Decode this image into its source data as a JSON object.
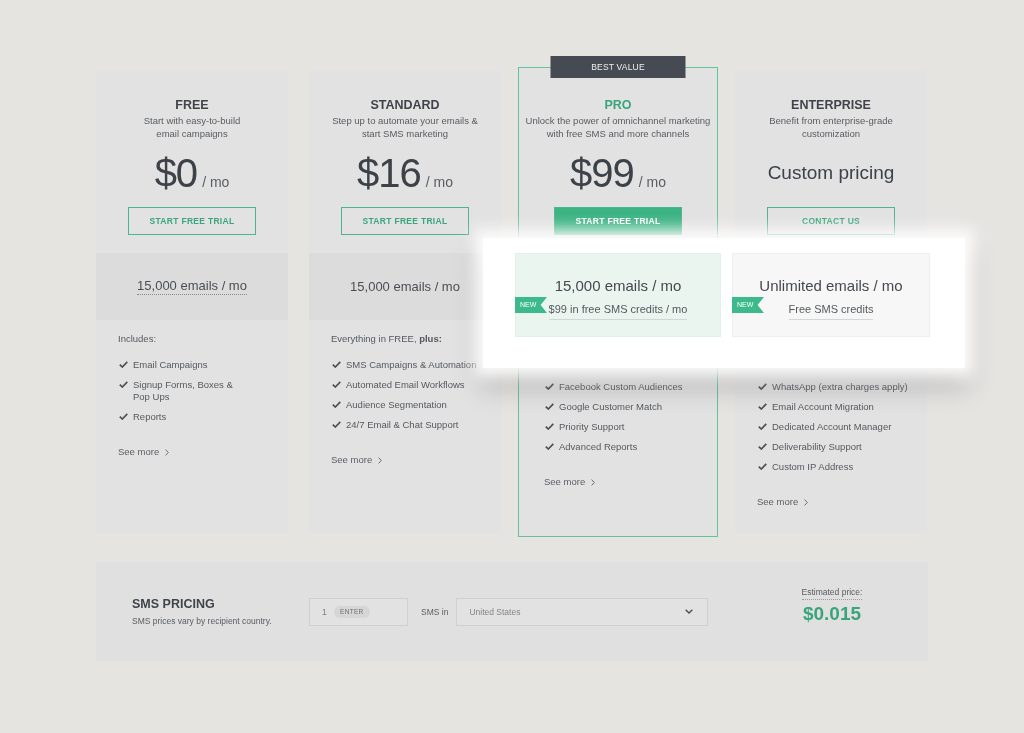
{
  "plans": [
    {
      "name": "FREE",
      "description": "Start with easy-to-build\nemail campaigns",
      "price": {
        "kind": "amount",
        "amount": "$0",
        "period": "/ mo"
      },
      "button": {
        "label": "START FREE TRIAL",
        "kind": "outline"
      },
      "highlighted": false,
      "emails": {
        "text": "15,000 emails / mo",
        "tooltip": true
      },
      "features_intro": "Includes:",
      "features": [
        "Email Campaigns",
        "Signup Forms, Boxes &\nPop Ups",
        "Reports"
      ],
      "see_more": "See more"
    },
    {
      "name": "STANDARD",
      "description": "Step up to automate your emails &\nstart SMS marketing",
      "price": {
        "kind": "amount",
        "amount": "$16",
        "period": "/ mo"
      },
      "button": {
        "label": "START FREE TRIAL",
        "kind": "outline"
      },
      "highlighted": false,
      "emails": {
        "text": "15,000 emails / mo",
        "tooltip": false
      },
      "features_intro": "Everything in FREE, **plus:**",
      "features": [
        "SMS Campaigns & Automation",
        "Automated Email Workflows",
        "Audience Segmentation",
        "24/7 Email & Chat Support"
      ],
      "see_more": "See more"
    },
    {
      "name": "PRO",
      "badge": "BEST VALUE",
      "description": "Unlock the power of omnichannel marketing\nwith free SMS and more channels",
      "price": {
        "kind": "amount",
        "amount": "$99",
        "period": "/ mo"
      },
      "button": {
        "label": "START FREE TRIAL",
        "kind": "filled"
      },
      "highlighted": true,
      "spotlight": {
        "emails": "15,000 emails / mo",
        "badge": "NEW",
        "note": "$99 in free SMS credits / mo"
      },
      "features": [
        "Facebook Custom Audiences",
        "Google Customer Match",
        "Priority Support",
        "Advanced Reports"
      ],
      "see_more": "See more"
    },
    {
      "name": "ENTERPRISE",
      "description": "Benefit from enterprise-grade\ncustomization",
      "price": {
        "kind": "custom",
        "label": "Custom pricing"
      },
      "button": {
        "label": "CONTACT US",
        "kind": "outline"
      },
      "highlighted": false,
      "spotlight": {
        "emails": "Unlimited emails / mo",
        "badge": "NEW",
        "note": "Free SMS credits"
      },
      "features": [
        "WhatsApp (extra charges apply)",
        "Email Account Migration",
        "Dedicated Account Manager",
        "Deliverability Support",
        "Custom IP Address"
      ],
      "see_more": "See more"
    }
  ],
  "sms_pricing": {
    "title": "SMS PRICING",
    "subtitle": "SMS prices vary by recipient country.",
    "quantity": {
      "placeholder": "1",
      "hint": "ENTER"
    },
    "country_label": "SMS in",
    "country": {
      "placeholder": "United States"
    },
    "estimate_label": "Estimated price:",
    "estimate": "$0.015"
  }
}
